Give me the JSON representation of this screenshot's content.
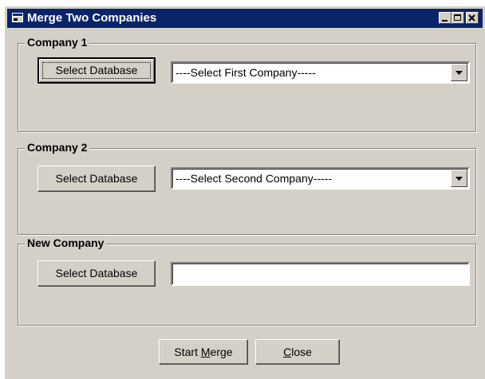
{
  "window": {
    "title": "Merge Two Companies",
    "icon": "app-window-icon",
    "controls": [
      "minimize-icon",
      "maximize-icon",
      "close-icon"
    ]
  },
  "company1": {
    "legend": "Company 1",
    "select_db_label": "Select Database",
    "dropdown_value": "----Select First Company-----"
  },
  "company2": {
    "legend": "Company 2",
    "select_db_label": "Select Database",
    "dropdown_value": "----Select Second Company-----"
  },
  "new_company": {
    "legend": "New Company",
    "select_db_label": "Select Database",
    "field_value": ""
  },
  "footer": {
    "start_merge": {
      "before": "Start ",
      "mnemonic": "M",
      "after": "erge"
    },
    "close": {
      "before": "",
      "mnemonic": "C",
      "after": "lose"
    }
  },
  "colors": {
    "titlebar": "#0a246a",
    "face": "#d4d0c8"
  }
}
